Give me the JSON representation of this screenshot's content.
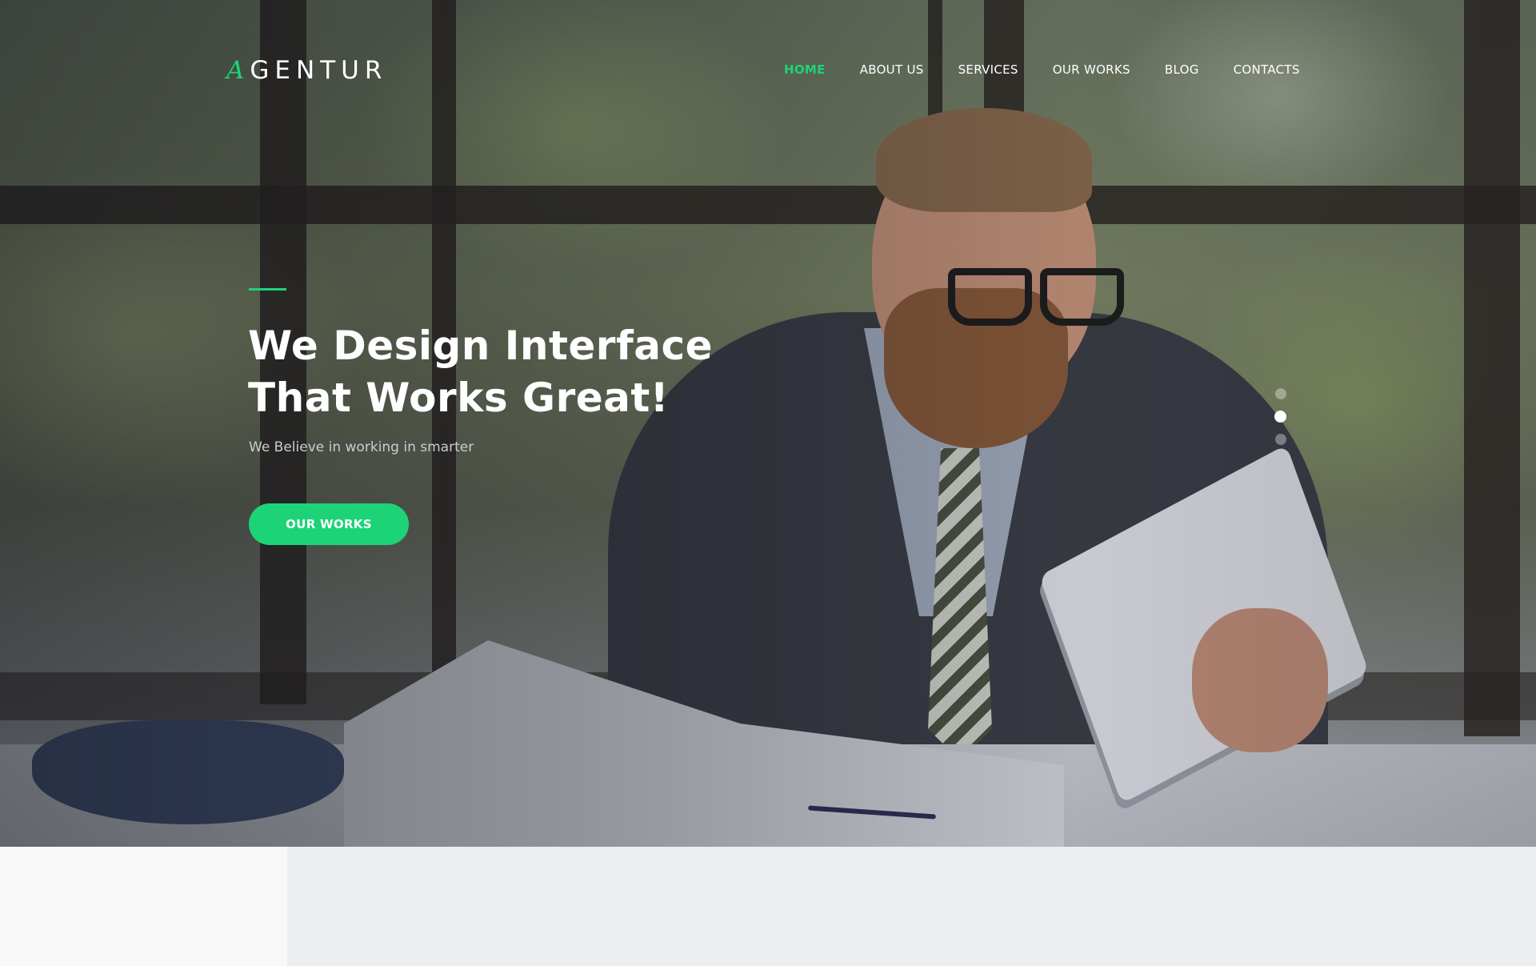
{
  "brand": {
    "logo_first": "A",
    "logo_rest": "GENTUR",
    "accent_color": "#1dd378"
  },
  "nav": {
    "items": [
      {
        "label": "HOME",
        "active": true
      },
      {
        "label": "ABOUT US",
        "active": false
      },
      {
        "label": "SERVICES",
        "active": false
      },
      {
        "label": "OUR WORKS",
        "active": false
      },
      {
        "label": "BLOG",
        "active": false
      },
      {
        "label": "CONTACTS",
        "active": false
      }
    ]
  },
  "hero": {
    "title_line1": "We Design Interface",
    "title_line2": "That Works Great!",
    "subtitle": "We Believe in working in smarter",
    "cta_label": "OUR WORKS",
    "slider": {
      "count": 3,
      "active_index": 1
    }
  }
}
